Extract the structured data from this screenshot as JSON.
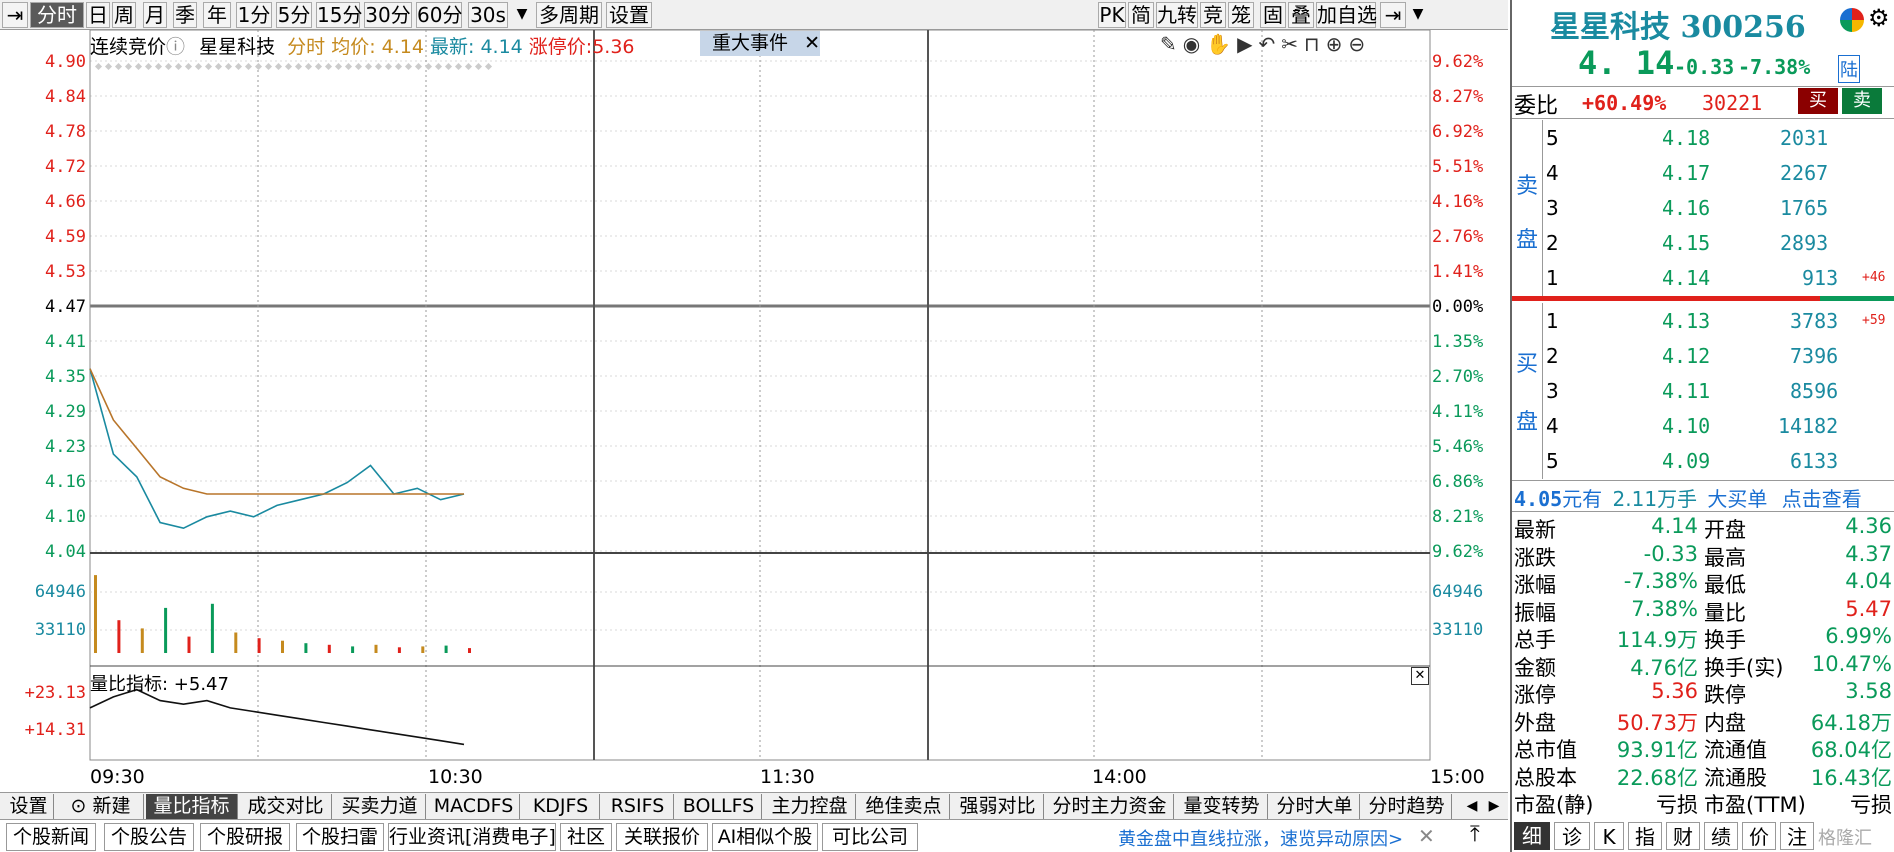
{
  "toolbar": {
    "tabs": [
      "分时",
      "日",
      "周",
      "月",
      "季",
      "年",
      "1分",
      "5分",
      "15分",
      "30分",
      "60分",
      "30s",
      "多周期",
      "设置"
    ],
    "right_buttons": [
      "PK",
      "简",
      "九转",
      "竞",
      "笼",
      "固",
      "叠",
      "加自选"
    ]
  },
  "chart": {
    "info": {
      "mode": "连续竞价",
      "stock": "星星科技",
      "fenshi_label": "分时",
      "avg_label": "均价: 4.14",
      "latest_label": "最新: 4.14",
      "limit_label": "涨停价:5.36"
    },
    "event_button": "重大事件",
    "price_ticks": [
      "4.90",
      "4.84",
      "4.78",
      "4.72",
      "4.66",
      "4.59",
      "4.53",
      "4.47",
      "4.41",
      "4.35",
      "4.29",
      "4.23",
      "4.16",
      "4.10",
      "4.04"
    ],
    "pct_ticks": [
      "9.62%",
      "8.27%",
      "6.92%",
      "5.51%",
      "4.16%",
      "2.76%",
      "1.41%",
      "0.00%",
      "1.35%",
      "2.70%",
      "4.11%",
      "5.46%",
      "6.86%",
      "8.21%",
      "9.62%"
    ],
    "vol_ticks": [
      "64946",
      "33110"
    ],
    "lb_ticks": [
      "+23.13",
      "+14.31"
    ],
    "lb_label": "量比指标: +5.47",
    "time_ticks": [
      "09:30",
      "10:30",
      "11:30",
      "14:00",
      "15:00"
    ]
  },
  "chart_data": {
    "type": "line",
    "x": [
      "09:30",
      "09:35",
      "09:40",
      "09:45",
      "09:50",
      "09:55",
      "10:00",
      "10:05",
      "10:10",
      "10:15",
      "10:20",
      "10:25",
      "10:30",
      "10:35",
      "10:40",
      "10:45",
      "10:50"
    ],
    "series": [
      {
        "name": "分时",
        "values": [
          4.36,
          4.21,
          4.17,
          4.09,
          4.08,
          4.1,
          4.11,
          4.1,
          4.12,
          4.13,
          4.14,
          4.16,
          4.19,
          4.14,
          4.15,
          4.13,
          4.14
        ]
      },
      {
        "name": "均价",
        "values": [
          4.36,
          4.27,
          4.22,
          4.17,
          4.15,
          4.14,
          4.14,
          4.14,
          4.14,
          4.14,
          4.14,
          4.14,
          4.14,
          4.14,
          4.14,
          4.14,
          4.14
        ]
      }
    ],
    "ylim": [
      4.04,
      4.9
    ],
    "volume": [
      95,
      40,
      30,
      55,
      20,
      60,
      25,
      18,
      15,
      12,
      10,
      8,
      10,
      7,
      8,
      9,
      6
    ],
    "volume_max": 97000,
    "lb_values": [
      18,
      21,
      23,
      20,
      19,
      20,
      18,
      17,
      16,
      15,
      14,
      13,
      12,
      11,
      10,
      9,
      8
    ]
  },
  "panel": {
    "title": "星星科技 300256",
    "price": "4. 14",
    "change": "-0.33",
    "change_pct": "-7.38%",
    "market_tag": "陆",
    "weibi_label": "委比",
    "weibi": "+60.49%",
    "weicha": "30221",
    "buy_btn": "买",
    "sell_btn": "卖",
    "sell_label": [
      "卖",
      "盘"
    ],
    "buy_label": [
      "买",
      "盘"
    ],
    "asks": [
      {
        "lvl": "5",
        "price": "4.18",
        "vol": "2031",
        "chg": ""
      },
      {
        "lvl": "4",
        "price": "4.17",
        "vol": "2267",
        "chg": ""
      },
      {
        "lvl": "3",
        "price": "4.16",
        "vol": "1765",
        "chg": ""
      },
      {
        "lvl": "2",
        "price": "4.15",
        "vol": "2893",
        "chg": ""
      },
      {
        "lvl": "1",
        "price": "4.14",
        "vol": "913",
        "chg": "+46"
      }
    ],
    "bids": [
      {
        "lvl": "1",
        "price": "4.13",
        "vol": "3783",
        "chg": "+59"
      },
      {
        "lvl": "2",
        "price": "4.12",
        "vol": "7396",
        "chg": ""
      },
      {
        "lvl": "3",
        "price": "4.11",
        "vol": "8596",
        "chg": ""
      },
      {
        "lvl": "4",
        "price": "4.10",
        "vol": "14182",
        "chg": ""
      },
      {
        "lvl": "5",
        "price": "4.09",
        "vol": "6133",
        "chg": ""
      }
    ],
    "big_order": {
      "price": "4.05",
      "unit": "元有",
      "amt": "2.11万手",
      "type": "大买单",
      "link": "点击查看"
    },
    "stats": [
      [
        "最新",
        "4.14",
        "开盘",
        "4.36"
      ],
      [
        "涨跌",
        "-0.33",
        "最高",
        "4.37"
      ],
      [
        "涨幅",
        "-7.38%",
        "最低",
        "4.04"
      ],
      [
        "振幅",
        "7.38%",
        "量比",
        "5.47"
      ],
      [
        "总手",
        "114.9万",
        "换手",
        "6.99%"
      ],
      [
        "金额",
        "4.76亿",
        "换手(实)",
        "10.47%"
      ],
      [
        "涨停",
        "5.36",
        "跌停",
        "3.58"
      ],
      [
        "外盘",
        "50.73万",
        "内盘",
        "64.18万"
      ],
      [
        "总市值",
        "93.91亿",
        "流通值",
        "68.04亿"
      ],
      [
        "总股本",
        "22.68亿",
        "流通股",
        "16.43亿"
      ],
      [
        "市盈(静)",
        "亏损",
        "市盈(TTM)",
        "亏损"
      ]
    ],
    "bottom_tabs": [
      "细",
      "诊",
      "K",
      "指",
      "财",
      "绩",
      "价",
      "注"
    ],
    "watermark": "格隆汇"
  },
  "bottom_tabs": [
    "设置",
    "新建",
    "量比指标",
    "成交对比",
    "买卖力道",
    "MACDFS",
    "KDJFS",
    "RSIFS",
    "BOLLFS",
    "主力控盘",
    "绝佳卖点",
    "强弱对比",
    "分时主力资金",
    "量变转势",
    "分时大单",
    "分时趋势"
  ],
  "news_tabs": [
    "个股新闻",
    "个股公告",
    "个股研报",
    "个股扫雷",
    "行业资讯[消费电子]",
    "社区",
    "关联报价",
    "AI相似个股",
    "可比公司"
  ],
  "news_ticker": "黄金盘中直线拉涨，速览异动原因>"
}
